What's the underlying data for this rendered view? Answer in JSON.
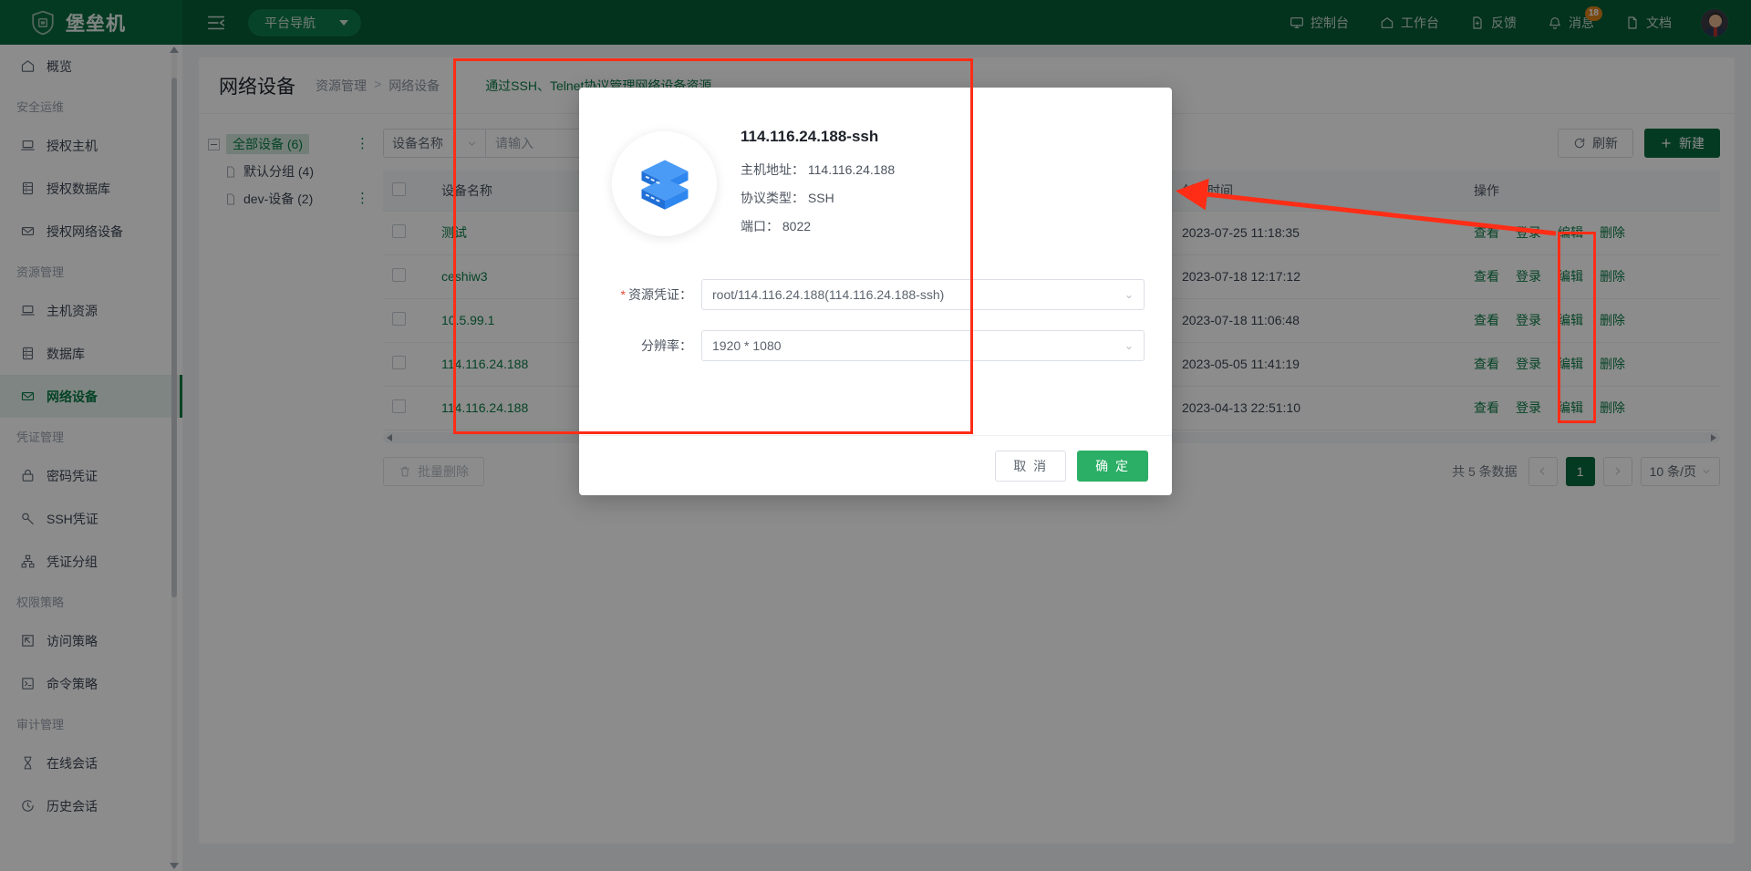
{
  "header": {
    "brand": "堡垒机",
    "brand_icon": "shield-icon",
    "collapse_icon": "menu-collapse-icon",
    "platform_nav": "平台导航",
    "nav_items": [
      {
        "label": "控制台",
        "icon": "monitor-icon"
      },
      {
        "label": "工作台",
        "icon": "home-icon"
      },
      {
        "label": "反馈",
        "icon": "file-feedback-icon"
      },
      {
        "label": "消息",
        "icon": "bell-icon",
        "badge": "18"
      },
      {
        "label": "文档",
        "icon": "document-icon"
      }
    ]
  },
  "sidebar": {
    "items": [
      {
        "type": "item",
        "label": "概览",
        "icon": "home-icon",
        "active": false
      },
      {
        "type": "group",
        "label": "安全运维"
      },
      {
        "type": "item",
        "label": "授权主机",
        "icon": "laptop-icon",
        "active": false
      },
      {
        "type": "item",
        "label": "授权数据库",
        "icon": "database-icon",
        "active": false
      },
      {
        "type": "item",
        "label": "授权网络设备",
        "icon": "router-icon",
        "active": false
      },
      {
        "type": "group",
        "label": "资源管理"
      },
      {
        "type": "item",
        "label": "主机资源",
        "icon": "laptop-icon",
        "active": false
      },
      {
        "type": "item",
        "label": "数据库",
        "icon": "database-icon",
        "active": false
      },
      {
        "type": "item",
        "label": "网络设备",
        "icon": "router-icon",
        "active": true
      },
      {
        "type": "group",
        "label": "凭证管理"
      },
      {
        "type": "item",
        "label": "密码凭证",
        "icon": "lock-icon",
        "active": false
      },
      {
        "type": "item",
        "label": "SSH凭证",
        "icon": "key-icon",
        "active": false
      },
      {
        "type": "item",
        "label": "凭证分组",
        "icon": "sitemap-icon",
        "active": false
      },
      {
        "type": "group",
        "label": "权限策略"
      },
      {
        "type": "item",
        "label": "访问策略",
        "icon": "cursor-box-icon",
        "active": false
      },
      {
        "type": "item",
        "label": "命令策略",
        "icon": "terminal-icon",
        "active": false
      },
      {
        "type": "group",
        "label": "审计管理"
      },
      {
        "type": "item",
        "label": "在线会话",
        "icon": "hourglass-icon",
        "active": false
      },
      {
        "type": "item",
        "label": "历史会话",
        "icon": "history-clock-icon",
        "active": false
      }
    ]
  },
  "page": {
    "title": "网络设备",
    "breadcrumb": [
      "资源管理",
      "网络设备"
    ],
    "breadcrumb_sep": ">",
    "description": "通过SSH、Telnet协议管理网络设备资源"
  },
  "tree": {
    "root": {
      "label": "全部设备 (6)",
      "selected": true
    },
    "children": [
      {
        "label": "默认分组 (4)"
      },
      {
        "label": "dev-设备 (2)"
      }
    ],
    "more_icon": "more-vertical-icon"
  },
  "toolbar": {
    "filter_field": "设备名称",
    "search_placeholder": "请输入",
    "refresh_label": "刷新",
    "refresh_icon": "refresh-icon",
    "create_label": "新建",
    "create_icon": "plus-icon"
  },
  "table": {
    "columns": [
      "",
      "设备名称",
      "创建时间",
      "操作"
    ],
    "rows": [
      {
        "name": "测试",
        "created": "2023-07-25 11:18:35"
      },
      {
        "name": "ceshiw3",
        "created": "2023-07-18 12:17:12"
      },
      {
        "name": "10.5.99.1",
        "created": "2023-07-18 11:06:48"
      },
      {
        "name": "114.116.24.188",
        "created": "2023-05-05 11:41:19"
      },
      {
        "name": "114.116.24.188",
        "created": "2023-04-13 22:51:10"
      }
    ],
    "actions": [
      "查看",
      "登录",
      "编辑",
      "删除"
    ]
  },
  "footer": {
    "bulk_delete": "批量删除",
    "bulk_delete_icon": "trash-icon",
    "total_text": "共 5 条数据",
    "prev_icon": "chevron-left-icon",
    "next_icon": "chevron-right-icon",
    "current_page": "1",
    "page_size": "10 条/页"
  },
  "modal": {
    "device_icon": "server-stack-icon",
    "title": "114.116.24.188-ssh",
    "details": [
      {
        "key": "主机地址：",
        "value": "114.116.24.188"
      },
      {
        "key": "协议类型：",
        "value": "SSH"
      },
      {
        "key": "端口：",
        "value": "8022"
      }
    ],
    "form": [
      {
        "label": "资源凭证：",
        "required": true,
        "value": "root/114.116.24.188(114.116.24.188-ssh)"
      },
      {
        "label": "分辨率：",
        "required": false,
        "value": "1920 * 1080"
      }
    ],
    "cancel_label": "取 消",
    "confirm_label": "确 定"
  },
  "annotation": {
    "color": "#ff2d16",
    "shapes": [
      "highlight-rect-modal",
      "highlight-rect-login-column",
      "arrow-pointer"
    ]
  }
}
